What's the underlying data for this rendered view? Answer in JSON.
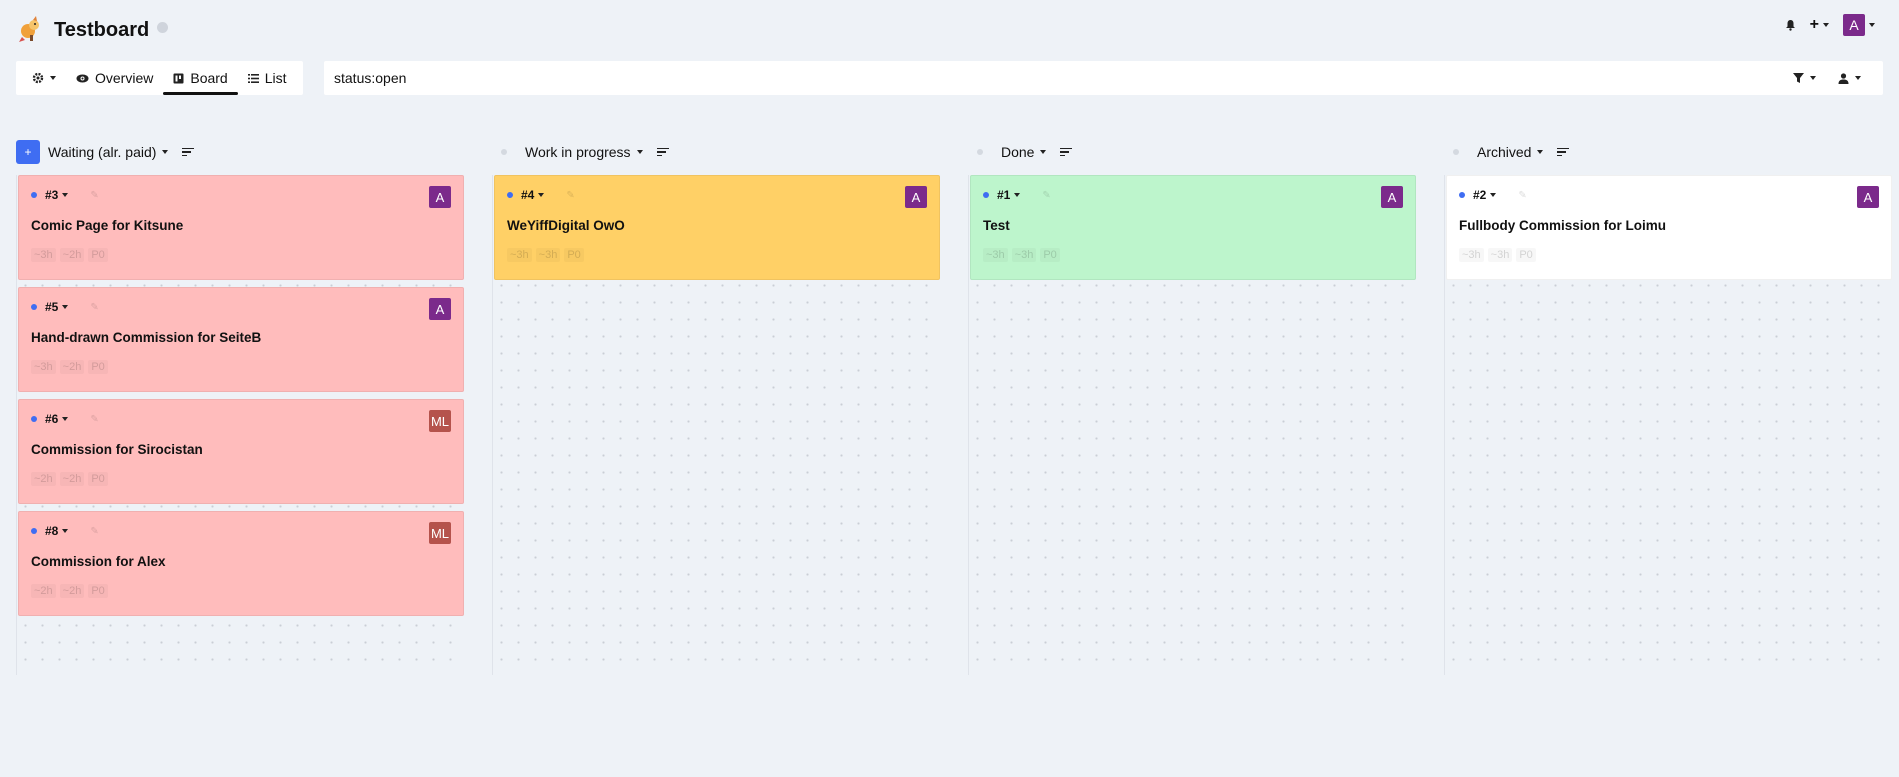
{
  "app": {
    "title": "Testboard",
    "accent": "#3f6df2",
    "avatar_color": "#7b2a8b",
    "user_initial": "A"
  },
  "toolbar": {
    "settings_icon": "gear-icon",
    "tabs": [
      {
        "label": "Overview",
        "icon": "eye-icon"
      },
      {
        "label": "Board",
        "icon": "board-icon"
      },
      {
        "label": "List",
        "icon": "list-icon"
      }
    ],
    "active_tab": "Board"
  },
  "filter": {
    "value": "status:open"
  },
  "columns": [
    {
      "title": "Waiting (alr. paid)",
      "has_add": true,
      "cards": [
        {
          "id": "#3",
          "title": "Comic Page for Kitsune",
          "assignee": "A",
          "assignee_color": "#7b2a8b",
          "color": "pink",
          "meta": [
            "~3h",
            "~2h",
            "P0"
          ]
        },
        {
          "id": "#5",
          "title": "Hand-drawn Commission for SeiteB",
          "assignee": "A",
          "assignee_color": "#7b2a8b",
          "color": "pink",
          "meta": [
            "~3h",
            "~2h",
            "P0"
          ]
        },
        {
          "id": "#6",
          "title": "Commission for Sirocistan",
          "assignee": "ML",
          "assignee_color": "#b5534c",
          "color": "pink",
          "meta": [
            "~2h",
            "~2h",
            "P0"
          ]
        },
        {
          "id": "#8",
          "title": "Commission for Alex",
          "assignee": "ML",
          "assignee_color": "#b5534c",
          "color": "pink",
          "meta": [
            "~2h",
            "~2h",
            "P0"
          ]
        }
      ]
    },
    {
      "title": "Work in progress",
      "has_add": false,
      "cards": [
        {
          "id": "#4",
          "title": "WeYiffDigital OwO",
          "assignee": "A",
          "assignee_color": "#7b2a8b",
          "color": "orange",
          "meta": [
            "~3h",
            "~3h",
            "P0"
          ]
        }
      ]
    },
    {
      "title": "Done",
      "has_add": false,
      "cards": [
        {
          "id": "#1",
          "title": "Test",
          "assignee": "A",
          "assignee_color": "#7b2a8b",
          "color": "green",
          "meta": [
            "~3h",
            "~3h",
            "P0"
          ]
        }
      ]
    },
    {
      "title": "Archived",
      "has_add": false,
      "cards": [
        {
          "id": "#2",
          "title": "Fullbody Commission for Loimu",
          "assignee": "A",
          "assignee_color": "#7b2a8b",
          "color": "white",
          "meta": [
            "~3h",
            "~3h",
            "P0"
          ]
        }
      ]
    }
  ]
}
